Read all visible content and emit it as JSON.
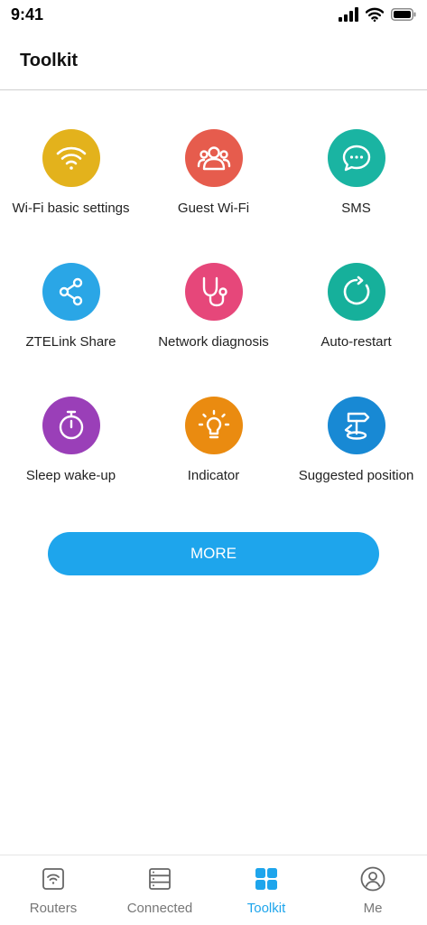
{
  "status_bar": {
    "time": "9:41"
  },
  "header": {
    "title": "Toolkit"
  },
  "tools": [
    {
      "label": "Wi-Fi basic settings",
      "icon": "wifi-icon",
      "color": "#e3b21c"
    },
    {
      "label": "Guest Wi-Fi",
      "icon": "guest-users-icon",
      "color": "#e65c4d"
    },
    {
      "label": "SMS",
      "icon": "chat-bubble-icon",
      "color": "#1ab4a2"
    },
    {
      "label": "ZTELink Share",
      "icon": "share-icon",
      "color": "#2aa6e6"
    },
    {
      "label": "Network diagnosis",
      "icon": "stethoscope-icon",
      "color": "#e6477a"
    },
    {
      "label": "Auto-restart",
      "icon": "restart-icon",
      "color": "#16b09b"
    },
    {
      "label": "Sleep wake-up",
      "icon": "stopwatch-icon",
      "color": "#9a3fb8"
    },
    {
      "label": "Indicator",
      "icon": "bulb-icon",
      "color": "#ea8b10"
    },
    {
      "label": "Suggested position",
      "icon": "signpost-icon",
      "color": "#1889d4"
    }
  ],
  "more_button": {
    "label": "MORE",
    "color": "#1ea5ec"
  },
  "tabbar": {
    "items": [
      {
        "label": "Routers",
        "icon": "router-icon",
        "active": false
      },
      {
        "label": "Connected",
        "icon": "devices-list-icon",
        "active": false
      },
      {
        "label": "Toolkit",
        "icon": "grid-icon",
        "active": true
      },
      {
        "label": "Me",
        "icon": "user-icon",
        "active": false
      }
    ],
    "active_color": "#1ea5ec",
    "inactive_color": "#777777"
  }
}
